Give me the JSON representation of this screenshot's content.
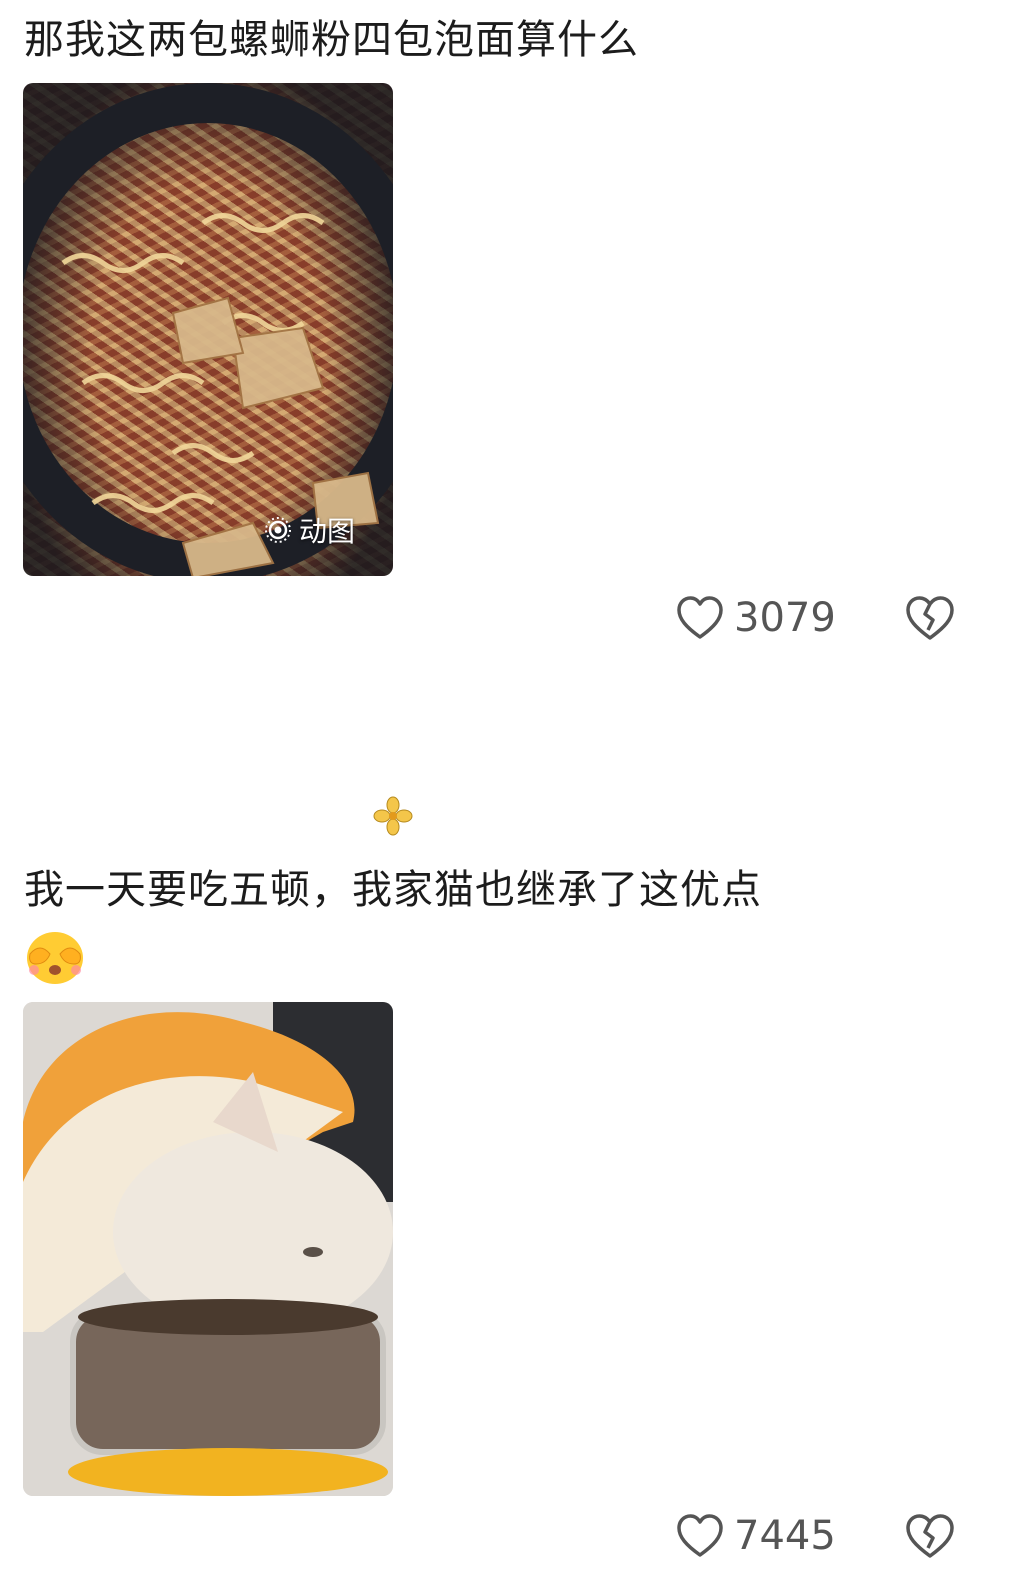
{
  "posts": [
    {
      "text": "那我这两包螺蛳粉四包泡面算什么",
      "media_badge": "动图",
      "likes": "3079"
    },
    {
      "text": "我一天要吃五顿，我家猫也继承了这优点",
      "likes": "7445"
    }
  ],
  "icons": {
    "like": "heart-outline-icon",
    "dislike": "broken-heart-icon",
    "gif": "live-photo-icon",
    "emoji": "face-covering-eyes-emoji",
    "divider": "flower-icon"
  },
  "colors": {
    "text": "#1c1c1c",
    "action": "#555555",
    "background": "#ffffff"
  }
}
